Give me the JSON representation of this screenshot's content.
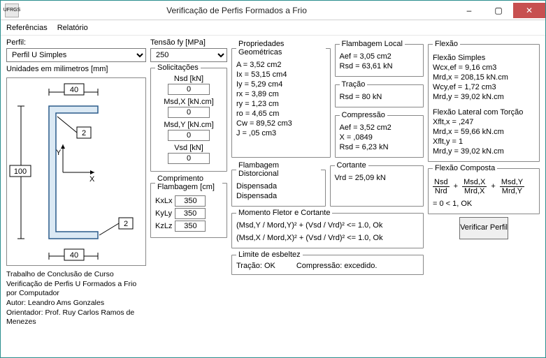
{
  "window": {
    "title": "Verificação de Perfis Formados a Frio",
    "minimize": "–",
    "maximize": "▢",
    "close": "✕",
    "logo": "UFRGS"
  },
  "menu": {
    "referencias": "Referências",
    "relatorio": "Relatório"
  },
  "perfil": {
    "label": "Perfil:",
    "value": "Perfil U Simples"
  },
  "tensao": {
    "label": "Tensão fy [MPa]",
    "value": "250"
  },
  "unidades": "Unidades em milimetros [mm]",
  "diagram": {
    "top": "40",
    "bottom": "40",
    "depth": "100",
    "t1": "2",
    "t2": "2",
    "y": "Y",
    "x": "X"
  },
  "credits": {
    "l1": "Trabalho de Conclusão de Curso",
    "l2": "Verificação de Perfis U Formados a Frio por Computador",
    "l3": "Autor: Leandro Ams Gonzales",
    "l4": "Orientador: Prof. Ruy Carlos Ramos de Menezes"
  },
  "solic": {
    "legend": "Solicitações",
    "nsd_label": "Nsd [kN]",
    "nsd": "0",
    "msdx_label": "Msd,X [kN.cm]",
    "msdx": "0",
    "msdy_label": "Msd,Y [kN.cm]",
    "msdy": "0",
    "vsd_label": "Vsd [kN]",
    "vsd": "0"
  },
  "cflam": {
    "legend": "Comprimento Flambagem [cm]",
    "kxlx_label": "KxLx",
    "kxlx": "350",
    "kyly_label": "KyLy",
    "kyly": "350",
    "kzlz_label": "KzLz",
    "kzlz": "350"
  },
  "geom": {
    "legend": "Propriedades Geométricas",
    "a": "A = 3,52 cm2",
    "ix": "Ix = 53,15 cm4",
    "iy": "Iy = 5,29 cm4",
    "rx": "rx = 3,89 cm",
    "ry": "ry = 1,23 cm",
    "ro": "ro = 4,65 cm",
    "cw": "Cw = 89,52 cm3",
    "j": "J = ,05 cm3"
  },
  "fdist": {
    "legend": "Flambagem Distorcional",
    "l1": "Dispensada",
    "l2": "Dispensada"
  },
  "flocal": {
    "legend": "Flambagem Local",
    "aef": "Aef = 3,05 cm2",
    "rsd": "Rsd = 63,61 kN"
  },
  "tracao": {
    "legend": "Tração",
    "rsd": "Rsd = 80 kN"
  },
  "comp": {
    "legend": "Compressão",
    "aef": "Aef = 3,52 cm2",
    "x": "X = ,0849",
    "rsd": "Rsd = 6,23 kN"
  },
  "cort": {
    "legend": "Cortante",
    "vrd": "Vrd = 25,09 kN"
  },
  "momento": {
    "legend": "Momento Fletor e Cortante",
    "l1": "(Msd,Y / Mord,Y)² + (Vsd / Vrd)²    <= 1.0, Ok",
    "l2": "(Msd,X / Mord,X)² + (Vsd / Vrd)²    <= 1.0, Ok"
  },
  "esbelt": {
    "legend": "Limite de esbeltez",
    "tracao": "Tração: OK",
    "comp": "Compressão: excedido."
  },
  "flexao": {
    "legend": "Flexão",
    "simples": "Flexão Simples",
    "wcx": "Wcx,ef = 9,16 cm3",
    "mrdx": "Mrd,x = 208,15 kN.cm",
    "wcy": "Wcy,ef = 1,72 cm3",
    "mrdy": "Mrd,y = 39,02 kN.cm",
    "lateral": "Flexão Lateral com Torção",
    "xfltx": "Xflt,x = ,247",
    "mrdx2": "Mrd,x = 59,66 kN.cm",
    "xflty": "Xflt,y = 1",
    "mrdy2": "Mrd,y = 39,02 kN.cm"
  },
  "fcomp": {
    "legend": "Flexão Composta",
    "nsd": "Nsd",
    "nrd": "Nrd",
    "msdx": "Msd,X",
    "mrdx": "Mrd,X",
    "msdy": "Msd,Y",
    "mrdy": "Mrd,Y",
    "result": " = 0 < 1, OK"
  },
  "verify": "Verificar Perfil"
}
